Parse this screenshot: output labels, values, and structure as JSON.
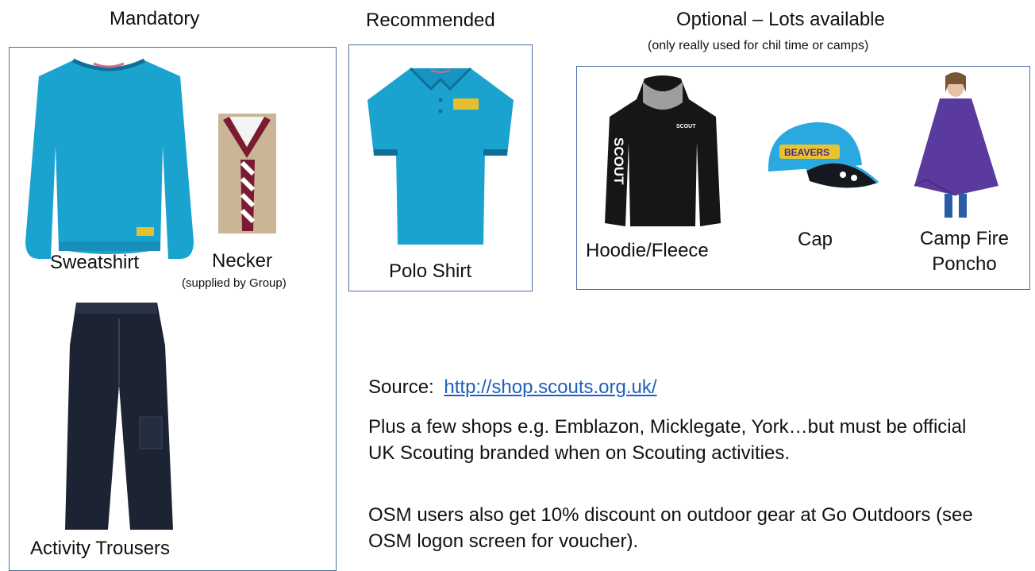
{
  "sections": {
    "mandatory": {
      "heading": "Mandatory",
      "items": {
        "sweatshirt": "Sweatshirt",
        "necker": "Necker",
        "necker_note": "(supplied by Group)",
        "trousers": "Activity Trousers"
      }
    },
    "recommended": {
      "heading": "Recommended",
      "items": {
        "polo": "Polo Shirt"
      }
    },
    "optional": {
      "heading": "Optional – Lots available",
      "subheading": "(only really used for chil time or camps)",
      "items": {
        "hoodie": "Hoodie/Fleece",
        "cap": "Cap",
        "poncho_line1": "Camp Fire",
        "poncho_line2": "Poncho"
      }
    }
  },
  "product_print": {
    "hoodie_sleeve": "SCOUT",
    "hoodie_chest": "SCOUT",
    "cap_badge": "BEAVERS"
  },
  "info": {
    "source_label": "Source:",
    "source_link": "http://shop.scouts.org.uk/",
    "shops_text": "Plus a few shops e.g. Emblazon, Micklegate, York…but must be official UK Scouting branded when on Scouting activities.",
    "osm_text": "OSM users also get 10% discount on outdoor gear at Go Outdoors (see OSM logon screen for voucher)."
  },
  "colors": {
    "box_border": "#4a6fa5",
    "teal": "#1ba3cf",
    "link": "#1f5fbf"
  }
}
